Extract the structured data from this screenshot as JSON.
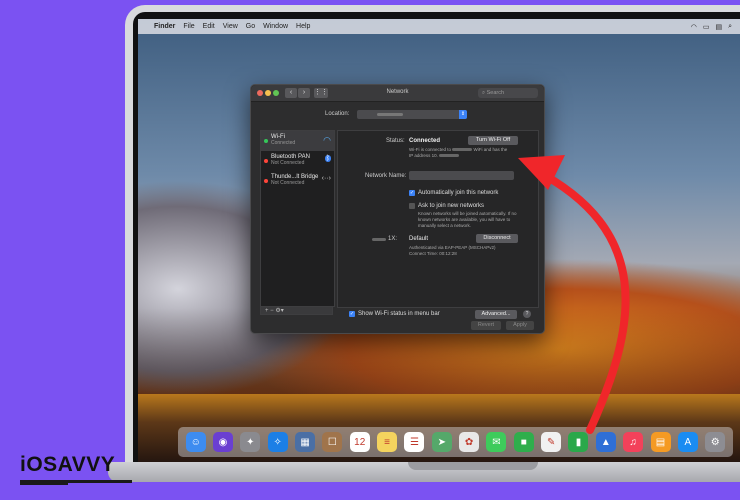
{
  "menubar": {
    "apple": "",
    "items": [
      "Finder",
      "File",
      "Edit",
      "View",
      "Go",
      "Window",
      "Help"
    ]
  },
  "window": {
    "title": "Network",
    "search_placeholder": "Search",
    "location_label": "Location:"
  },
  "services": [
    {
      "name": "Wi-Fi",
      "status": "Connected",
      "dot": "#35c759",
      "icon": "wifi-icon"
    },
    {
      "name": "Bluetooth PAN",
      "status": "Not Connected",
      "dot": "#ff453a",
      "icon": "bluetooth-icon"
    },
    {
      "name": "Thunde...lt Bridge",
      "status": "Not Connected",
      "dot": "#ff453a",
      "icon": "thunderbolt-icon"
    }
  ],
  "list_footer": "+   −   ⚙▾",
  "panel": {
    "status_label": "Status:",
    "status_value": "Connected",
    "turn_off_button": "Turn Wi-Fi Off",
    "status_desc_1": "Wi-Fi is connected to",
    "status_desc_2": "WiFi and has the",
    "status_desc_3": "IP address 10.",
    "network_name_label": "Network Name:",
    "auto_join": "Automatically join this network",
    "ask_join": "Ask to join new networks",
    "ask_desc": "Known networks will be joined automatically. If no known networks are available, you will have to manually select a network.",
    "x_label": "1X:",
    "x_value": "Default",
    "disconnect_button": "Disconnect",
    "auth_1": "Authenticated via EAP-PEAP (MSCHAPv2)",
    "auth_2": "Connect Time: 00:12:28"
  },
  "footer": {
    "show_status": "Show Wi-Fi status in menu bar",
    "advanced_button": "Advanced...",
    "help": "?",
    "revert_button": "Revert",
    "apply_button": "Apply"
  },
  "dock_icons": [
    {
      "name": "finder",
      "glyph": "☺",
      "color": "#3d8cf0"
    },
    {
      "name": "siri",
      "glyph": "◉",
      "color": "#6a3fd1"
    },
    {
      "name": "launchpad",
      "glyph": "✦",
      "color": "#8a8a8f"
    },
    {
      "name": "safari",
      "glyph": "✧",
      "color": "#1c7fe6"
    },
    {
      "name": "photos-browser",
      "glyph": "▦",
      "color": "#4a6fa5"
    },
    {
      "name": "contacts",
      "glyph": "☐",
      "color": "#a0744b"
    },
    {
      "name": "calendar",
      "glyph": "12",
      "color": "#ffffff"
    },
    {
      "name": "notes",
      "glyph": "≡",
      "color": "#f4d35e"
    },
    {
      "name": "reminders",
      "glyph": "☰",
      "color": "#ffffff"
    },
    {
      "name": "maps",
      "glyph": "➤",
      "color": "#55a86a"
    },
    {
      "name": "photos",
      "glyph": "✿",
      "color": "#e8e8e8"
    },
    {
      "name": "messages",
      "glyph": "✉",
      "color": "#3ecb5b"
    },
    {
      "name": "facetime",
      "glyph": "■",
      "color": "#2fae4c"
    },
    {
      "name": "pages",
      "glyph": "✎",
      "color": "#f1f1f1"
    },
    {
      "name": "numbers",
      "glyph": "▮",
      "color": "#2aa84a"
    },
    {
      "name": "keynote",
      "glyph": "▲",
      "color": "#2f6fd6"
    },
    {
      "name": "music",
      "glyph": "♫",
      "color": "#f3415a"
    },
    {
      "name": "books",
      "glyph": "▤",
      "color": "#f59a23"
    },
    {
      "name": "app-store",
      "glyph": "A",
      "color": "#1a8cf2"
    },
    {
      "name": "system-preferences",
      "glyph": "⚙",
      "color": "#8d8d93"
    }
  ],
  "logo": "iOSAVVY"
}
